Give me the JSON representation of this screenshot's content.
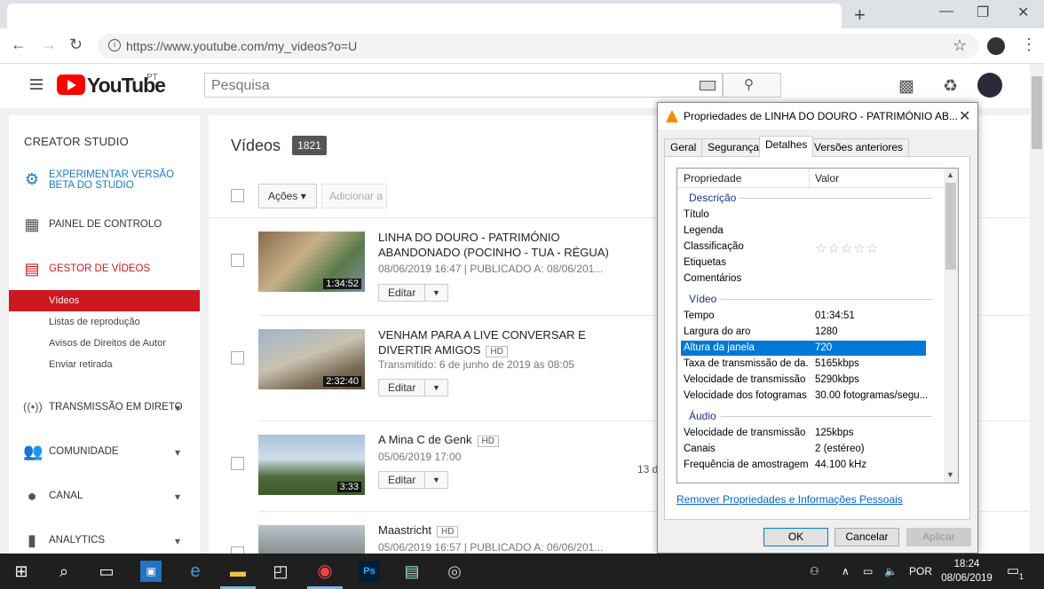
{
  "browser": {
    "url": "https://www.youtube.com/my_videos?o=U",
    "new_tab": "+",
    "min": "—",
    "max": "❐",
    "close": "✕"
  },
  "youtube": {
    "logo": "YouTube",
    "region": "PT",
    "search_placeholder": "Pesquisa"
  },
  "sidebar": {
    "title": "CREATOR STUDIO",
    "beta_line1": "EXPERIMENTAR VERSÃO",
    "beta_line2": "BETA DO STUDIO",
    "items": [
      {
        "label": "PAINEL DE CONTROLO"
      },
      {
        "label": "GESTOR DE VÍDEOS"
      },
      {
        "label": "TRANSMISSÃO EM DIRETO"
      },
      {
        "label": "COMUNIDADE"
      },
      {
        "label": "CANAL"
      },
      {
        "label": "ANALYTICS"
      }
    ],
    "sub": [
      "Vídeos",
      "Listas de reprodução",
      "Avisos de Direitos de Autor",
      "Enviar retirada"
    ]
  },
  "main": {
    "title": "Vídeos",
    "count": "1821",
    "actions": "Ações",
    "add_to": "Adicionar a",
    "edit": "Editar",
    "videos": [
      {
        "title1": "LINHA DO DOURO - PATRIMÓNIO",
        "title2": "ABANDONADO (POCINHO - TUA - RÉGUA)",
        "meta": "08/06/2019 16:47 | PUBLICADO A: 08/06/201...",
        "duration": "1:34:52"
      },
      {
        "title1": "VENHAM PARA A LIVE CONVERSAR E",
        "title2": "DIVERTIR AMIGOS",
        "hd": "HD",
        "meta": "Transmitido: 6 de junho de 2019 às 08:05",
        "duration": "2:32:40"
      },
      {
        "title1": "A Mina C de Genk",
        "hd": "HD",
        "meta": "05/06/2019 17:00",
        "duration": "3:33",
        "side": "13 d"
      },
      {
        "title1": "Maastricht",
        "hd": "HD",
        "meta": "05/06/2019 16:57 | PUBLICADO A: 06/06/201..."
      }
    ]
  },
  "dialog": {
    "title": "Propriedades de LINHA DO DOURO - PATRIMÓNIO AB...",
    "tabs": [
      "Geral",
      "Segurança",
      "Detalhes",
      "Versões anteriores"
    ],
    "col_prop": "Propriedade",
    "col_val": "Valor",
    "groups": {
      "desc": "Descrição",
      "video": "Vídeo",
      "audio": "Áudio"
    },
    "desc_rows": [
      "Título",
      "Legenda",
      "Classificação",
      "Etiquetas",
      "Comentários"
    ],
    "rating_stars": "☆☆☆☆☆",
    "video_rows": [
      {
        "p": "Tempo",
        "v": "01:34:51"
      },
      {
        "p": "Largura do aro",
        "v": "1280"
      },
      {
        "p": "Altura da janela",
        "v": "720"
      },
      {
        "p": "Taxa de transmissão de da...",
        "v": "5165kbps"
      },
      {
        "p": "Velocidade de transmissão ...",
        "v": "5290kbps"
      },
      {
        "p": "Velocidade dos fotogramas",
        "v": "30.00 fotogramas/segu..."
      }
    ],
    "audio_rows": [
      {
        "p": "Velocidade de transmissão",
        "v": "125kbps"
      },
      {
        "p": "Canais",
        "v": "2 (estéreo)"
      },
      {
        "p": "Frequência de amostragem ...",
        "v": "44.100 kHz"
      }
    ],
    "link": "Remover Propriedades e Informações Pessoais",
    "ok": "OK",
    "cancel": "Cancelar",
    "apply": "Aplicar"
  },
  "taskbar": {
    "lang": "POR",
    "time": "18:24",
    "date": "08/06/2019",
    "notif": "1"
  }
}
